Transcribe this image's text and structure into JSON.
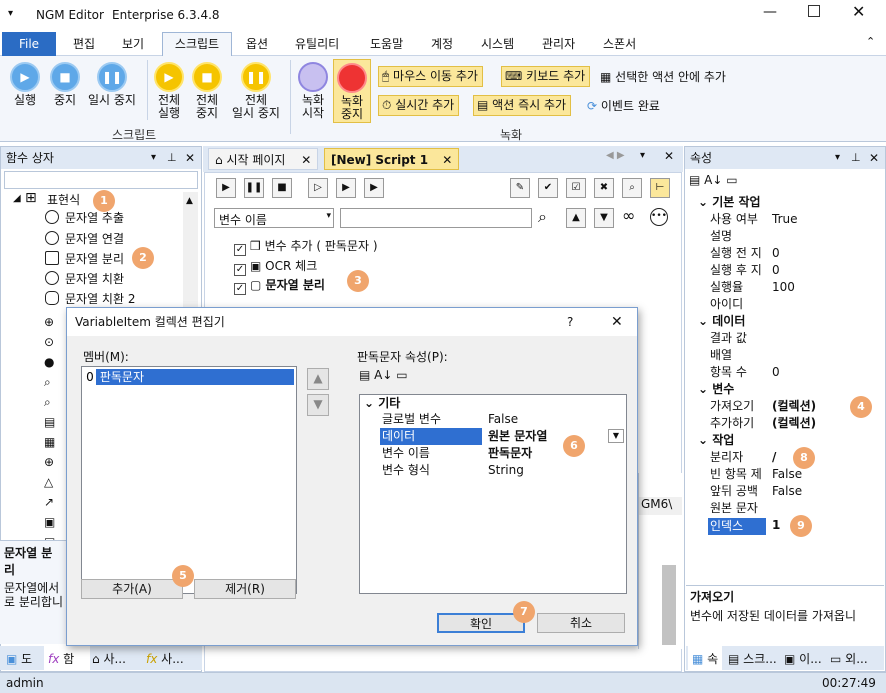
{
  "window": {
    "app_name": "NGM Editor",
    "edition": "Enterprise 6.3.4.8"
  },
  "menu": [
    "File",
    "편집",
    "보기",
    "스크립트",
    "옵션",
    "유틸리티",
    "도움말",
    "계정",
    "시스템",
    "관리자",
    "스폰서"
  ],
  "ribbon": {
    "script_buttons": [
      "실행",
      "중지",
      "일시 중지"
    ],
    "all_buttons": [
      [
        "전체",
        "실행"
      ],
      [
        "전체",
        "중지"
      ],
      [
        "전체",
        "일시 중지"
      ]
    ],
    "script_group": "스크립트",
    "record_buttons": [
      [
        "녹화",
        "시작"
      ],
      [
        "녹화",
        "중지"
      ]
    ],
    "record_actions": [
      "마우스 이동 추가",
      "키보드 추가",
      "실시간 추가",
      "액션 즉시 추가"
    ],
    "selected_action_label": "선택한 액션 안에 추가",
    "event_done_label": "이벤트 완료",
    "record_group": "녹화"
  },
  "left_pane": {
    "title": "함수 상자",
    "root": "표현식",
    "items": [
      "문자열 추출",
      "문자열 연결",
      "문자열 분리",
      "문자열 치환",
      "문자열 치환 2"
    ],
    "desc_title": "문자열 분리",
    "desc_text": "문자열에서\n로 분리합니",
    "bottom_tabs": [
      "도",
      "함",
      "사...",
      "사..."
    ]
  },
  "doc_tabs": [
    "시작 페이지",
    "[New] Script 1"
  ],
  "editor": {
    "var_select": "변수 이름",
    "actions": [
      "변수 추가 ( 판독문자 )",
      "OCR 체크",
      "문자열 분리"
    ],
    "side_fragment": "GM6\\"
  },
  "dialog": {
    "title": "VariableItem 컬렉션 편집기",
    "help": "?",
    "members_label": "멤버(M):",
    "members": [
      {
        "index": "0",
        "name": "판독문자"
      }
    ],
    "props_label": "판독문자 속성(P):",
    "category": "기타",
    "props": [
      {
        "key": "글로벌 변수",
        "value": "False"
      },
      {
        "key": "데이터",
        "value": "원본 문자열"
      },
      {
        "key": "변수 이름",
        "value": "판독문자"
      },
      {
        "key": "변수 형식",
        "value": "String"
      }
    ],
    "add_button": "추가(A)",
    "remove_button": "제거(R)",
    "ok_button": "확인",
    "cancel_button": "취소"
  },
  "props_pane": {
    "title": "속성",
    "sections": [
      {
        "name": "기본 작업",
        "rows": [
          [
            "사용 여부",
            "True"
          ],
          [
            "설명",
            ""
          ],
          [
            "실행 전 지",
            "0"
          ],
          [
            "실행 후 지",
            "0"
          ],
          [
            "실행율",
            "100"
          ],
          [
            "아이디",
            ""
          ]
        ]
      },
      {
        "name": "데이터",
        "rows": [
          [
            "결과 값",
            ""
          ],
          [
            "배열",
            ""
          ],
          [
            "항목 수",
            "0"
          ]
        ]
      },
      {
        "name": "변수",
        "rows": [
          [
            "가져오기",
            "(컬렉션)"
          ],
          [
            "추가하기",
            "(컬렉션)"
          ]
        ]
      },
      {
        "name": "작업",
        "rows": [
          [
            "분리자",
            "/"
          ],
          [
            "빈 항목 제",
            "False"
          ],
          [
            "앞뒤 공백",
            "False"
          ],
          [
            "원본 문자",
            ""
          ],
          [
            "인덱스",
            "1"
          ]
        ]
      }
    ],
    "desc_title": "가져오기",
    "desc_text": "변수에 저장된 데이터를 가져옵니",
    "bottom_tabs": [
      "속",
      "스크...",
      "이...",
      "외..."
    ]
  },
  "status": {
    "user": "admin",
    "time": "00:27:49"
  },
  "badges": [
    "1",
    "2",
    "3",
    "4",
    "5",
    "6",
    "7",
    "8",
    "9"
  ],
  "colors": {
    "accent": "#2b6cc4",
    "badge": "#f0a56d",
    "highlight": "#2f6fd1"
  }
}
